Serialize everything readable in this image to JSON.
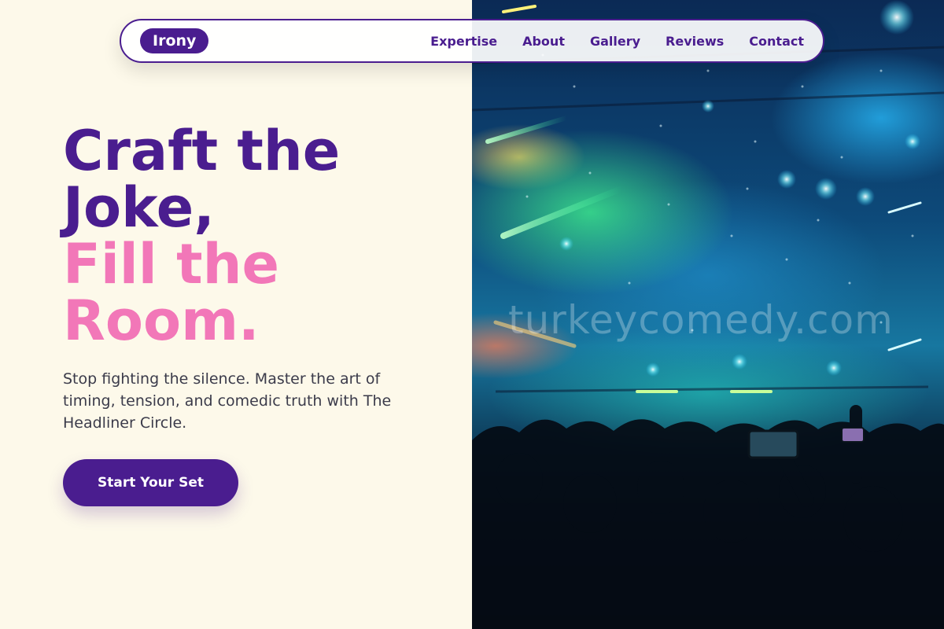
{
  "navbar": {
    "brand": "Irony",
    "links": [
      {
        "label": "Expertise"
      },
      {
        "label": "About"
      },
      {
        "label": "Gallery"
      },
      {
        "label": "Reviews"
      },
      {
        "label": "Contact"
      }
    ]
  },
  "hero": {
    "headline_line1": "Craft the",
    "headline_line2": "Joke,",
    "headline_line3": "Fill the",
    "headline_line4": "Room.",
    "subtext": "Stop fighting the silence. Master the art of timing, tension, and comedic truth with The Headliner Circle.",
    "cta_label": "Start Your Set",
    "image_watermark": "turkeycomedy.com"
  },
  "colors": {
    "background": "#fdf9ea",
    "primary_purple": "#4a1d8f",
    "accent_pink": "#f277b8",
    "body_text": "#3b3b4a"
  }
}
